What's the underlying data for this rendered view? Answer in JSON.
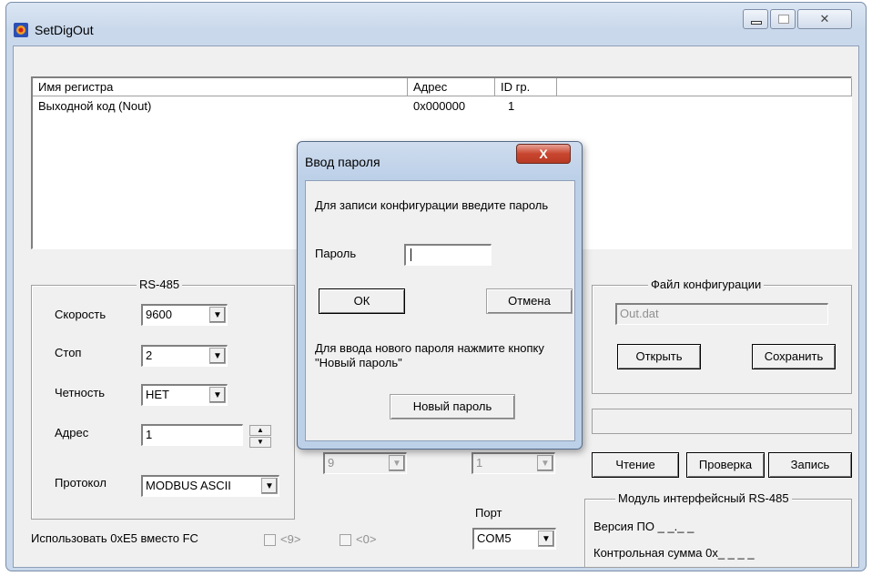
{
  "window": {
    "title": "SetDigOut",
    "minimize": "▭",
    "maximize": "▫",
    "close": "✕"
  },
  "list": {
    "columns": [
      "Имя регистра",
      "Адрес",
      "ID гр."
    ],
    "rows": [
      {
        "name": "Выходной код (Nout)",
        "address": "0x000000",
        "id": "1"
      }
    ]
  },
  "rs485": {
    "title": "RS-485",
    "speed_label": "Скорость",
    "speed_value": "9600",
    "stop_label": "Стоп",
    "stop_value": "2",
    "parity_label": "Четность",
    "parity_value": "НЕТ",
    "address_label": "Адрес",
    "address_value": "1",
    "protocol_label": "Протокол",
    "protocol_value": "MODBUS ASCII"
  },
  "misc": {
    "use_e5_label": "Использовать 0xE5 вместо FC",
    "chk9_label": "<9>",
    "chk0_label": "<0>",
    "combo_a": "9",
    "combo_b": "1",
    "port_label": "Порт",
    "port_value": "COM5"
  },
  "config_file": {
    "title": "Файл конфигурации",
    "file_value": "Out.dat",
    "open_label": "Открыть",
    "save_label": "Сохранить"
  },
  "actions": {
    "read_label": "Чтение",
    "check_label": "Проверка",
    "write_label": "Запись"
  },
  "module": {
    "title": "Модуль интерфейсный RS-485",
    "version_label": "Версия ПО _ _._ _",
    "checksum_label": "Контрольная сумма 0x_ _ _ _"
  },
  "dialog": {
    "title": "Ввод пароля",
    "close": "X",
    "prompt": "Для записи конфигурации введите пароль",
    "password_label": "Пароль",
    "password_value": "",
    "ok_label": "ОК",
    "cancel_label": "Отмена",
    "hint": "Для ввода нового пароля нажмите кнопку \"Новый пароль\"",
    "new_password_label": "Новый пароль"
  },
  "colors": {
    "close_button": "#c9462f",
    "title_bar": "#c9d8eb",
    "client_bg": "#f0f0f0"
  }
}
